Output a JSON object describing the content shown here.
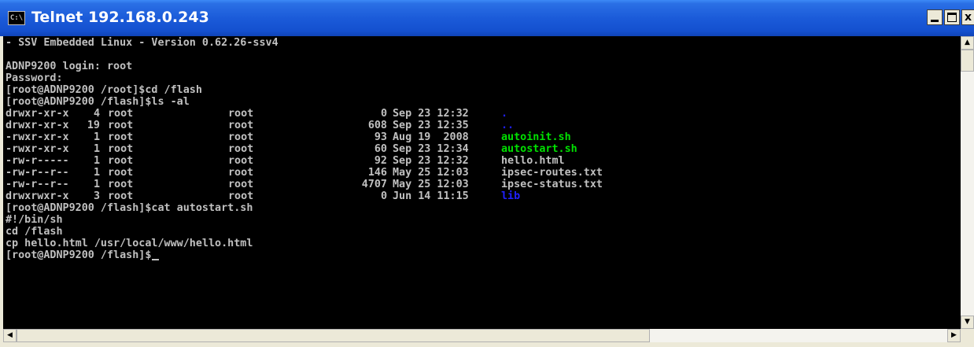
{
  "window": {
    "title": "Telnet 192.168.0.243",
    "icon_label": "C:\\",
    "icon_name": "console-icon",
    "min_label": "",
    "max_label": "",
    "close_label": "x"
  },
  "terminal": {
    "fg_color": "#c0c0c0",
    "bg_color": "#000000",
    "exec_color": "#00e000",
    "dir_color": "#2020ff",
    "header_lines": [
      "- SSV Embedded Linux - Version 0.62.26-ssv4",
      "",
      "ADNP9200 login: root",
      "Password:",
      "[root@ADNP9200 /root]$cd /flash",
      "[root@ADNP9200 /flash]$ls -al"
    ],
    "listing": [
      {
        "perm": "drwxr-xr-x",
        "links": "4",
        "owner": "root",
        "group": "root",
        "size": "0",
        "date": "Sep 23 12:32",
        "name": ".",
        "kind": "dir"
      },
      {
        "perm": "drwxr-xr-x",
        "links": "19",
        "owner": "root",
        "group": "root",
        "size": "608",
        "date": "Sep 23 12:35",
        "name": "..",
        "kind": "dir"
      },
      {
        "perm": "-rwxr-xr-x",
        "links": "1",
        "owner": "root",
        "group": "root",
        "size": "93",
        "date": "Aug 19  2008",
        "name": "autoinit.sh",
        "kind": "exec"
      },
      {
        "perm": "-rwxr-xr-x",
        "links": "1",
        "owner": "root",
        "group": "root",
        "size": "60",
        "date": "Sep 23 12:34",
        "name": "autostart.sh",
        "kind": "exec"
      },
      {
        "perm": "-rw-r-----",
        "links": "1",
        "owner": "root",
        "group": "root",
        "size": "92",
        "date": "Sep 23 12:32",
        "name": "hello.html",
        "kind": "file"
      },
      {
        "perm": "-rw-r--r--",
        "links": "1",
        "owner": "root",
        "group": "root",
        "size": "146",
        "date": "May 25 12:03",
        "name": "ipsec-routes.txt",
        "kind": "file"
      },
      {
        "perm": "-rw-r--r--",
        "links": "1",
        "owner": "root",
        "group": "root",
        "size": "4707",
        "date": "May 25 12:03",
        "name": "ipsec-status.txt",
        "kind": "file"
      },
      {
        "perm": "drwxrwxr-x",
        "links": "3",
        "owner": "root",
        "group": "root",
        "size": "0",
        "date": "Jun 14 11:15",
        "name": "lib",
        "kind": "dir"
      }
    ],
    "footer_lines": [
      "[root@ADNP9200 /flash]$cat autostart.sh",
      "#!/bin/sh",
      "cd /flash",
      "cp hello.html /usr/local/www/hello.html"
    ],
    "prompt": "[root@ADNP9200 /flash]$"
  },
  "scrollbars": {
    "vertical": {
      "up_icon": "arrow-up-icon",
      "down_icon": "arrow-down-icon",
      "up_glyph": "▲",
      "down_glyph": "▼",
      "position": 0.0
    },
    "horizontal": {
      "left_icon": "arrow-left-icon",
      "right_icon": "arrow-right-icon",
      "left_glyph": "◀",
      "right_glyph": "▶",
      "position": 0.0
    }
  }
}
